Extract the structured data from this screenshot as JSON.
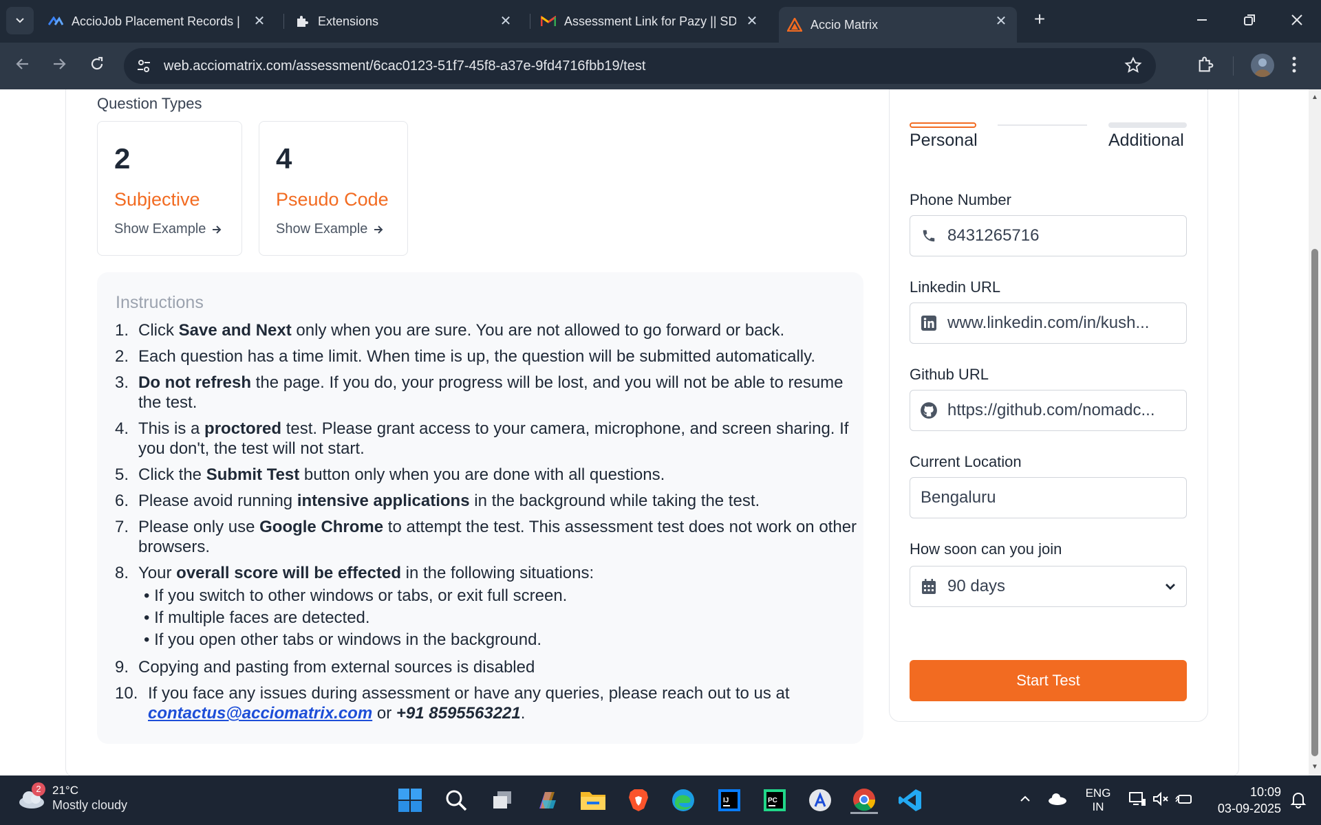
{
  "browser": {
    "tabs": [
      {
        "title": "AccioJob Placement Records | S",
        "icon": "acciojob-icon"
      },
      {
        "title": "Extensions",
        "icon": "puzzle-icon"
      },
      {
        "title": "Assessment Link for Pazy || SDE",
        "icon": "gmail-icon"
      },
      {
        "title": "Accio Matrix",
        "icon": "accio-matrix-icon"
      }
    ],
    "url": "web.acciomatrix.com/assessment/6cac0123-51f7-45f8-a37e-9fd4716fbb19/test"
  },
  "question_types": {
    "title": "Question Types",
    "cards": [
      {
        "count": "2",
        "label": "Subjective",
        "link": "Show Example"
      },
      {
        "count": "4",
        "label": "Pseudo Code",
        "link": "Show Example"
      }
    ]
  },
  "instructions": {
    "title": "Instructions",
    "items": [
      {
        "num": "1.",
        "pre": "Click ",
        "bold": "Save and Next",
        "post": " only when you are sure. You are not allowed to go forward or back."
      },
      {
        "num": "2.",
        "pre": "Each question has a time limit. When time is up, the question will be submitted automatically.",
        "bold": "",
        "post": ""
      },
      {
        "num": "3.",
        "pre": "",
        "bold": "Do not refresh",
        "post": " the page. If you do, your progress will be lost, and you will not be able to resume the test."
      },
      {
        "num": "4.",
        "pre": "This is a ",
        "bold": "proctored",
        "post": " test. Please grant access to your camera, microphone, and screen sharing. If you don't, the test will not start."
      },
      {
        "num": "5.",
        "pre": "Click the ",
        "bold": "Submit Test",
        "post": " button only when you are done with all questions."
      },
      {
        "num": "6.",
        "pre": "Please avoid running ",
        "bold": "intensive applications",
        "post": " in the background while taking the test."
      },
      {
        "num": "7.",
        "pre": "Please only use ",
        "bold": "Google Chrome",
        "post": " to attempt the test. This assessment test does not work on other browsers."
      },
      {
        "num": "8.",
        "pre": "Your ",
        "bold": "overall score will be effected",
        "post": " in the following situations:"
      },
      {
        "num": "9.",
        "pre": "Copying and pasting from external sources is disabled",
        "bold": "",
        "post": ""
      },
      {
        "num": "10.",
        "pre": "If you face any issues during assessment or have any queries, please reach out to us at",
        "bold": "",
        "post": ""
      }
    ],
    "sub_items": [
      "• If you switch to other windows or tabs, or exit full screen.",
      "• If multiple faces are detected.",
      "• If you open other tabs or windows in the background."
    ],
    "contact_email": "contactus@acciomatrix.com",
    "contact_or": " or ",
    "contact_phone": "+91 8595563221",
    "contact_end": "."
  },
  "form": {
    "steps": [
      "Personal",
      "Additional"
    ],
    "phone_label": "Phone Number",
    "phone_value": "8431265716",
    "linkedin_label": "Linkedin URL",
    "linkedin_value": "www.linkedin.com/in/kush...",
    "github_label": "Github URL",
    "github_value": "https://github.com/nomadc...",
    "location_label": "Current Location",
    "location_value": "Bengaluru",
    "join_label": "How soon can you join",
    "join_value": "90 days",
    "start_button": "Start Test"
  },
  "taskbar": {
    "weather_badge": "2",
    "temperature": "21°C",
    "condition": "Mostly cloudy",
    "lang_top": "ENG",
    "lang_bottom": "IN",
    "time": "10:09",
    "date": "03-09-2025"
  },
  "colors": {
    "accent": "#f26b21",
    "link": "#1d4ed8",
    "chrome_dark": "#202a37"
  }
}
